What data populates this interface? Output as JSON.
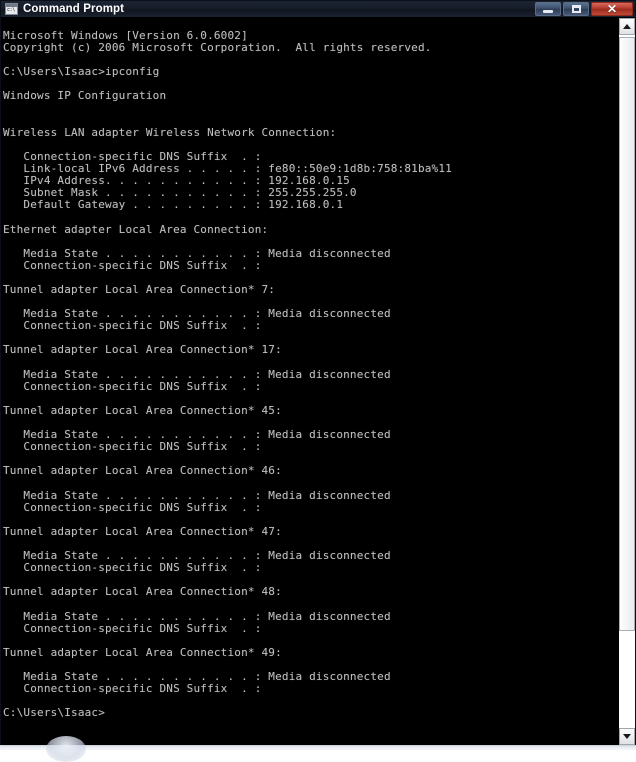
{
  "window": {
    "title": "Command Prompt",
    "icon": "console-window-icon",
    "icon_glyph": "c:\\",
    "colors": {
      "titlebar": "#161c29",
      "console_background": "#000000",
      "console_foreground": "#c0c0c0",
      "close_button": "#b33a2c",
      "scrollbar_track": "#ffffff"
    },
    "buttons": [
      {
        "name": "minimize",
        "glyph": "minimize-icon",
        "label": "Minimize"
      },
      {
        "name": "restore",
        "glyph": "restore-icon",
        "label": "Maximize"
      },
      {
        "name": "close",
        "glyph": "close-icon",
        "label": "Close"
      }
    ]
  },
  "scrollbar": {
    "up_button_label": "scroll-up",
    "down_button_label": "scroll-down",
    "thumb_label": "scroll-thumb"
  },
  "console": {
    "prompt_user_path": "C:\\Users\\Isaac>",
    "command": "ipconfig",
    "banner": [
      "Microsoft Windows [Version 6.0.6002]",
      "Copyright (c) 2006 Microsoft Corporation.  All rights reserved."
    ],
    "section_title": "Windows IP Configuration",
    "adapters": [
      {
        "heading": "Wireless LAN adapter Wireless Network Connection:",
        "fields": [
          {
            "label": "Connection-specific DNS Suffix",
            "dots": "  . ",
            "value": ""
          },
          {
            "label": "Link-local IPv6 Address",
            "dots": " . . . . . ",
            "value": "fe80::50e9:1d8b:758:81ba%11"
          },
          {
            "label": "IPv4 Address. . . . . . . . . . ",
            "dots": "",
            "value": "192.168.0.15"
          },
          {
            "label": "Subnet Mask . . . . . . . . . . ",
            "dots": "",
            "value": "255.255.255.0"
          },
          {
            "label": "Default Gateway . . . . . . . . ",
            "dots": "",
            "value": "192.168.0.1"
          }
        ]
      },
      {
        "heading": "Ethernet adapter Local Area Connection:",
        "fields": [
          {
            "label": "Media State . . . . . . . . . . ",
            "dots": "",
            "value": "Media disconnected"
          },
          {
            "label": "Connection-specific DNS Suffix",
            "dots": "  . ",
            "value": ""
          }
        ]
      },
      {
        "heading": "Tunnel adapter Local Area Connection* 7:",
        "fields": [
          {
            "label": "Media State . . . . . . . . . . ",
            "dots": "",
            "value": "Media disconnected"
          },
          {
            "label": "Connection-specific DNS Suffix",
            "dots": "  . ",
            "value": ""
          }
        ]
      },
      {
        "heading": "Tunnel adapter Local Area Connection* 17:",
        "fields": [
          {
            "label": "Media State . . . . . . . . . . ",
            "dots": "",
            "value": "Media disconnected"
          },
          {
            "label": "Connection-specific DNS Suffix",
            "dots": "  . ",
            "value": ""
          }
        ]
      },
      {
        "heading": "Tunnel adapter Local Area Connection* 45:",
        "fields": [
          {
            "label": "Media State . . . . . . . . . . ",
            "dots": "",
            "value": "Media disconnected"
          },
          {
            "label": "Connection-specific DNS Suffix",
            "dots": "  . ",
            "value": ""
          }
        ]
      },
      {
        "heading": "Tunnel adapter Local Area Connection* 46:",
        "fields": [
          {
            "label": "Media State . . . . . . . . . . ",
            "dots": "",
            "value": "Media disconnected"
          },
          {
            "label": "Connection-specific DNS Suffix",
            "dots": "  . ",
            "value": ""
          }
        ]
      },
      {
        "heading": "Tunnel adapter Local Area Connection* 47:",
        "fields": [
          {
            "label": "Media State . . . . . . . . . . ",
            "dots": "",
            "value": "Media disconnected"
          },
          {
            "label": "Connection-specific DNS Suffix",
            "dots": "  . ",
            "value": ""
          }
        ]
      },
      {
        "heading": "Tunnel adapter Local Area Connection* 48:",
        "fields": [
          {
            "label": "Media State . . . . . . . . . . ",
            "dots": "",
            "value": "Media disconnected"
          },
          {
            "label": "Connection-specific DNS Suffix",
            "dots": "  . ",
            "value": ""
          }
        ]
      },
      {
        "heading": "Tunnel adapter Local Area Connection* 49:",
        "fields": [
          {
            "label": "Media State . . . . . . . . . . ",
            "dots": "",
            "value": "Media disconnected"
          },
          {
            "label": "Connection-specific DNS Suffix",
            "dots": "  . ",
            "value": ""
          }
        ]
      }
    ],
    "full_text": "Microsoft Windows [Version 6.0.6002]\nCopyright (c) 2006 Microsoft Corporation.  All rights reserved.\n\nC:\\Users\\Isaac>ipconfig\n\nWindows IP Configuration\n\n\nWireless LAN adapter Wireless Network Connection:\n\n   Connection-specific DNS Suffix  . :\n   Link-local IPv6 Address . . . . . : fe80::50e9:1d8b:758:81ba%11\n   IPv4 Address. . . . . . . . . . . : 192.168.0.15\n   Subnet Mask . . . . . . . . . . . : 255.255.255.0\n   Default Gateway . . . . . . . . . : 192.168.0.1\n\nEthernet adapter Local Area Connection:\n\n   Media State . . . . . . . . . . . : Media disconnected\n   Connection-specific DNS Suffix  . :\n\nTunnel adapter Local Area Connection* 7:\n\n   Media State . . . . . . . . . . . : Media disconnected\n   Connection-specific DNS Suffix  . :\n\nTunnel adapter Local Area Connection* 17:\n\n   Media State . . . . . . . . . . . : Media disconnected\n   Connection-specific DNS Suffix  . :\n\nTunnel adapter Local Area Connection* 45:\n\n   Media State . . . . . . . . . . . : Media disconnected\n   Connection-specific DNS Suffix  . :\n\nTunnel adapter Local Area Connection* 46:\n\n   Media State . . . . . . . . . . . : Media disconnected\n   Connection-specific DNS Suffix  . :\n\nTunnel adapter Local Area Connection* 47:\n\n   Media State . . . . . . . . . . . : Media disconnected\n   Connection-specific DNS Suffix  . :\n\nTunnel adapter Local Area Connection* 48:\n\n   Media State . . . . . . . . . . . : Media disconnected\n   Connection-specific DNS Suffix  . :\n\nTunnel adapter Local Area Connection* 49:\n\n   Media State . . . . . . . . . . . : Media disconnected\n   Connection-specific DNS Suffix  . :\n\nC:\\Users\\Isaac>"
  }
}
